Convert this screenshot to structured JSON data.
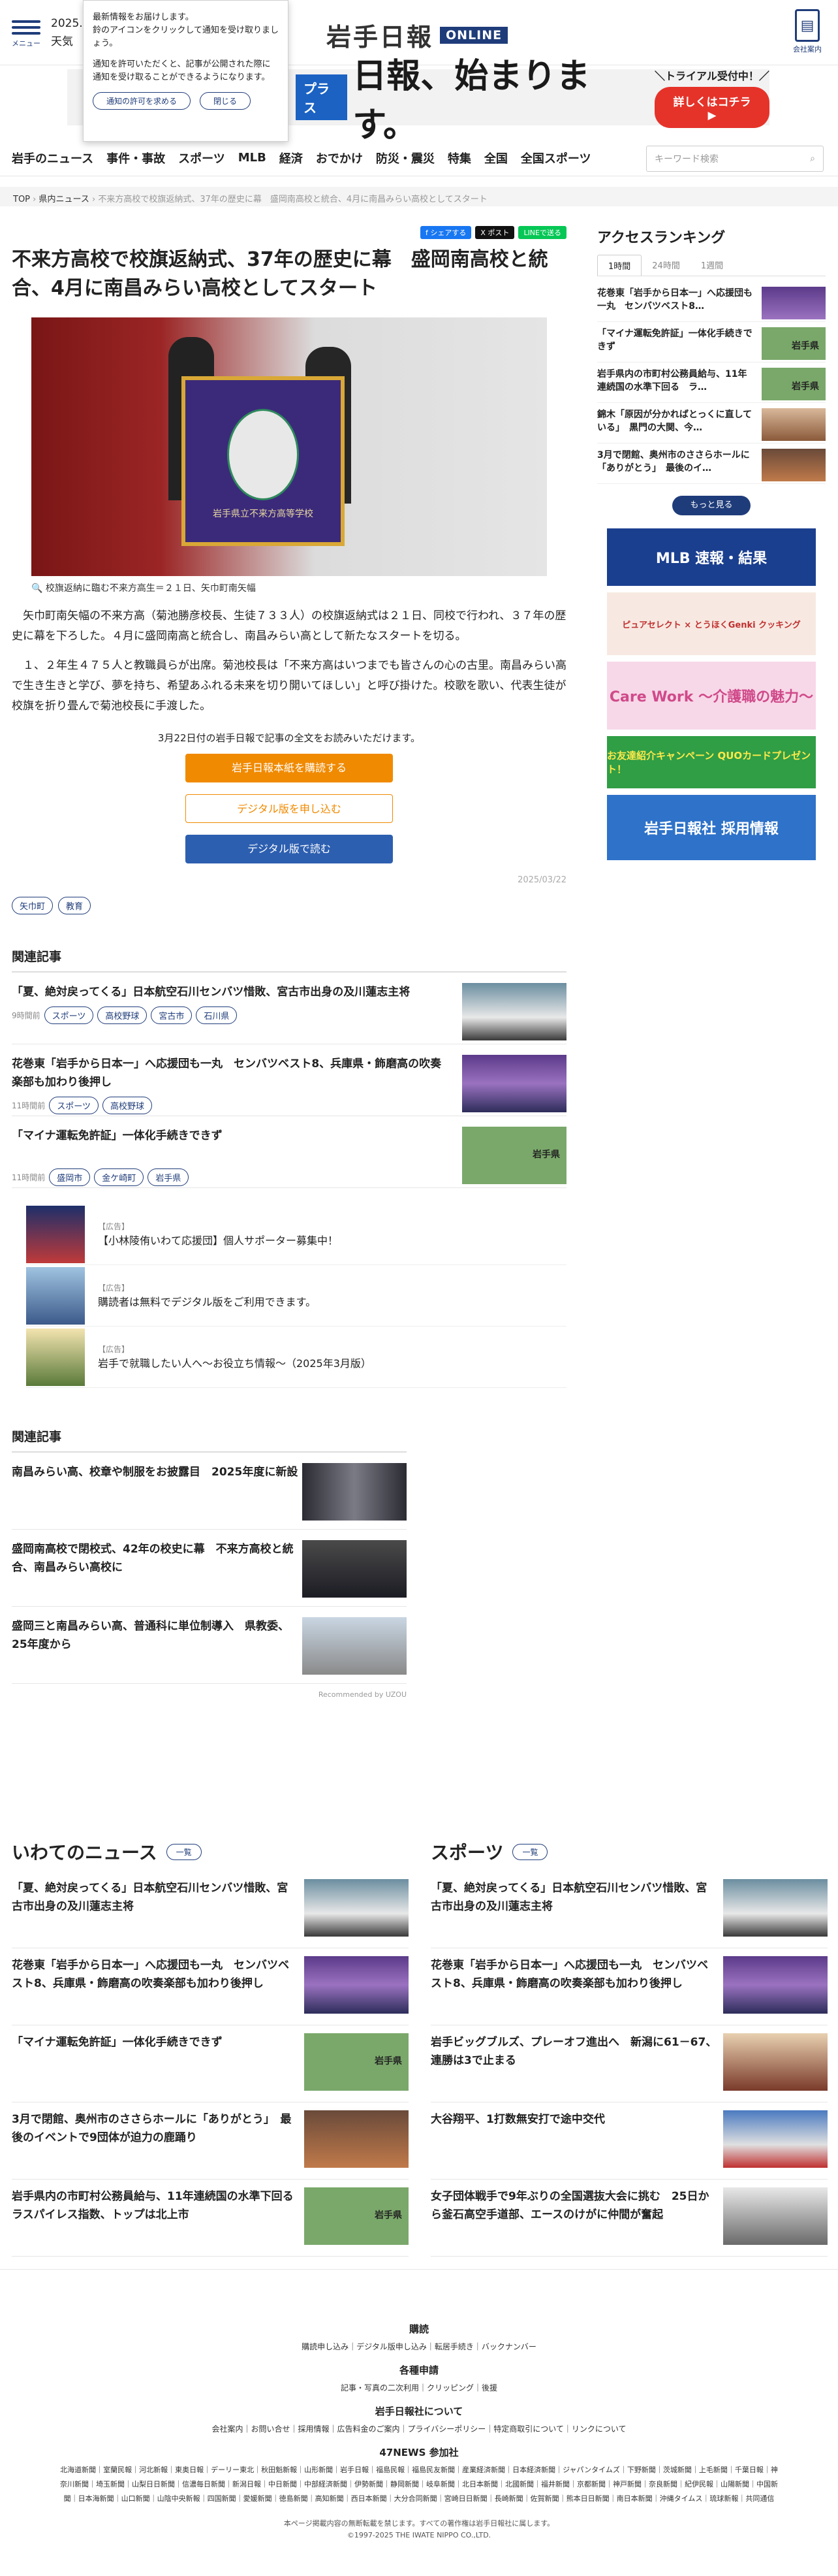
{
  "header": {
    "menu_label": "メニュー",
    "date_line1": "2025.",
    "date_line2": "天気",
    "logo_text": "岩手日報",
    "logo_badge": "ONLINE",
    "company_label": "会社案内",
    "company_icon": "newspaper-icon"
  },
  "popup": {
    "line1": "最新情報をお届けします。",
    "line2": "鈴のアイコンをクリックして通知を受け取りましょう。",
    "line3": "通知を許可いただくと、記事が公開された際に通知を受け取ることができるようになります。",
    "allow_label": "通知の許可を求める",
    "close_label": "閉じる"
  },
  "banner": {
    "plus": "プラス",
    "headline": "日報、始まります。",
    "trial": "＼トライアル受付中！／",
    "cta": "詳しくはコチラ ▶"
  },
  "nav": {
    "items": [
      "岩手のニュース",
      "事件・事故",
      "スポーツ",
      "MLB",
      "経済",
      "おでかけ",
      "防災・震災",
      "特集",
      "全国",
      "全国スポーツ"
    ],
    "search_placeholder": "キーワード検索"
  },
  "breadcrumb": {
    "top": "TOP",
    "sep": "›",
    "cat": "県内ニュース",
    "current": "不来方高校で校旗返納式、37年の歴史に幕　盛岡南高校と統合、4月に南昌みらい高校としてスタート"
  },
  "article": {
    "share": [
      "f シェアする",
      "X ポスト",
      "LINEで送る"
    ],
    "title": "不来方高校で校旗返納式、37年の歴史に幕　盛岡南高校と統合、4月に南昌みらい高校としてスタート",
    "photo_flag_text": "岩手県立不来方高等学校",
    "caption": "校旗返納に臨む不来方高生＝２１日、矢巾町南矢幅",
    "paragraphs": [
      "矢巾町南矢幅の不来方高（菊池勝彦校長、生徒７３３人）の校旗返納式は２１日、同校で行われ、３７年の歴史に幕を下ろした。４月に盛岡南高と統合し、南昌みらい高として新たなスタートを切る。",
      "１、２年生４７５人と教職員らが出席。菊池校長は「不来方高はいつまでも皆さんの心の古里。南昌みらい高で生き生きと学び、夢を持ち、希望あふれる未来を切り開いてほしい」と呼び掛けた。校歌を歌い、代表生徒が校旗を折り畳んで菊池校長に手渡した。"
    ],
    "paywall_notice": "3月22日付の岩手日報で記事の全文をお読みいただけます。",
    "buy_label": "岩手日報本紙を購読する",
    "digital_label": "デジタル版を申し込む",
    "read_label": "デジタル版で読む",
    "date": "2025/03/22",
    "tags": [
      "矢巾町",
      "教育"
    ]
  },
  "related": {
    "heading": "関連記事",
    "items": [
      {
        "title": "「夏、絶対戻ってくる」日本航空石川センバツ惜敗、宮古市出身の及川蓮志主将",
        "time": "9時間前",
        "tags": [
          "スポーツ",
          "高校野球",
          "宮古市",
          "石川県"
        ]
      },
      {
        "title": "花巻東「岩手から日本一」へ応援団も一丸　センバツベスト8、兵庫県・飾磨高の吹奏楽部も加わり後押し",
        "time": "11時間前",
        "tags": [
          "スポーツ",
          "高校野球"
        ]
      },
      {
        "title": "「マイナ運転免許証」一体化手続きできず",
        "time": "11時間前",
        "tags": [
          "盛岡市",
          "金ケ崎町",
          "岩手県"
        ]
      }
    ]
  },
  "ads": {
    "label": "【広告】",
    "items": [
      "【小林陵侑いわて応援団】個人サポーター募集中！",
      "購読者は無料でデジタル版をご利用できます。",
      "岩手で就職したい人へ～お役立ち情報～（2025年3月版）"
    ]
  },
  "recommended": {
    "heading": "関連記事",
    "items": [
      "南昌みらい高、校章や制服をお披露目　2025年度に新設",
      "盛岡南高校で閉校式、42年の校史に幕　不来方高校と統合、南昌みらい高校に",
      "盛岡三と南昌みらい高、普通科に単位制導入　県教委、25年度から"
    ],
    "by": "Recommended by UZOU"
  },
  "ranking": {
    "heading": "アクセスランキング",
    "tabs": [
      "1時間",
      "24時間",
      "1週間"
    ],
    "items": [
      "花巻東「岩手から日本一」へ応援団も一丸　センバツベスト8…",
      "「マイナ運転免許証」一体化手続きできず",
      "岩手県内の市町村公務員給与、11年連続国の水準下回る　ラ…",
      "錦木「原因が分かればとっくに直している」　黒門の大関、今…",
      "3月で閉館、奥州市のささらホールに「ありがとう」　最後のイ…"
    ],
    "more": "もっと見る"
  },
  "side_ads": [
    {
      "text": "MLB 速報・結果",
      "bg": "#1b3f8f",
      "fg": "#ffffff"
    },
    {
      "text": "ピュアセレクト × とうほくGenki クッキング",
      "bg": "#f7e9e1",
      "fg": "#c03030"
    },
    {
      "text": "Care Work ～介護職の魅力～",
      "bg": "#f7d8e8",
      "fg": "#d04a8a"
    },
    {
      "text": "お友達紹介キャンペーン QUOカードプレゼント！",
      "bg": "#2f9e45",
      "fg": "#ffe94a"
    },
    {
      "text": "岩手日報社 採用情報",
      "bg": "#2e72c9",
      "fg": "#ffffff"
    }
  ],
  "iwate_news": {
    "heading": "いわてのニュース",
    "btn": "一覧",
    "items": [
      "「夏、絶対戻ってくる」日本航空石川センバツ惜敗、宮古市出身の及川蓮志主将",
      "花巻東「岩手から日本一」へ応援団も一丸　センバツベスト8、兵庫県・飾磨高の吹奏楽部も加わり後押し",
      "「マイナ運転免許証」一体化手続きできず",
      "3月で閉館、奥州市のささらホールに「ありがとう」　最後のイベントで9団体が迫力の鹿踊り",
      "岩手県内の市町村公務員給与、11年連続国の水準下回る　ラスパイレス指数、トップは北上市"
    ]
  },
  "sports": {
    "heading": "スポーツ",
    "btn": "一覧",
    "items": [
      "「夏、絶対戻ってくる」日本航空石川センバツ惜敗、宮古市出身の及川蓮志主将",
      "花巻東「岩手から日本一」へ応援団も一丸　センバツベスト8、兵庫県・飾磨高の吹奏楽部も加わり後押し",
      "岩手ビッグブルズ、プレーオフ進出へ　新潟に61－67、連勝は3で止まる",
      "大谷翔平、1打数無安打で途中交代",
      "女子団体戦手で9年ぶりの全国選抜大会に挑む　25日から釜石高空手道部、エースのけがに仲間が奮起"
    ]
  },
  "footer": {
    "sub_heading": "購読",
    "sub_links": "購読申し込み｜デジタル版申し込み｜転居手続き｜バックナンバー",
    "app_heading": "各種申請",
    "app_links": "記事・写真の二次利用｜クリッピング｜後援",
    "about_heading": "岩手日報社について",
    "about_links": "会社案内｜お問い合せ｜採用情報｜広告料金のご案内｜プライバシーポリシー｜特定商取引について｜リンクについて",
    "news47_heading": "47NEWS 参加社",
    "news47": "北海道新聞｜室蘭民報｜河北新報｜東奥日報｜デーリー東北｜秋田魁新報｜山形新聞｜岩手日報｜福島民報｜福島民友新聞｜産業経済新聞｜日本経済新聞｜ジャパンタイムズ｜下野新聞｜茨城新聞｜上毛新聞｜千葉日報｜神奈川新聞｜埼玉新聞｜山梨日日新聞｜信濃毎日新聞｜新潟日報｜中日新聞｜中部経済新聞｜伊勢新聞｜静岡新聞｜岐阜新聞｜北日本新聞｜北國新聞｜福井新聞｜京都新聞｜神戸新聞｜奈良新聞｜紀伊民報｜山陽新聞｜中国新聞｜日本海新聞｜山口新聞｜山陰中央新報｜四国新聞｜愛媛新聞｜徳島新聞｜高知新聞｜西日本新聞｜大分合同新聞｜宮崎日日新聞｜長崎新聞｜佐賀新聞｜熊本日日新聞｜南日本新聞｜沖縄タイムス｜琉球新報｜共同通信",
    "copyright1": "本ページ掲載内容の無断転載を禁じます。すべての著作権は岩手日報社に属します。",
    "copyright2": "©1997-2025 THE IWATE NIPPO CO.,LTD."
  }
}
